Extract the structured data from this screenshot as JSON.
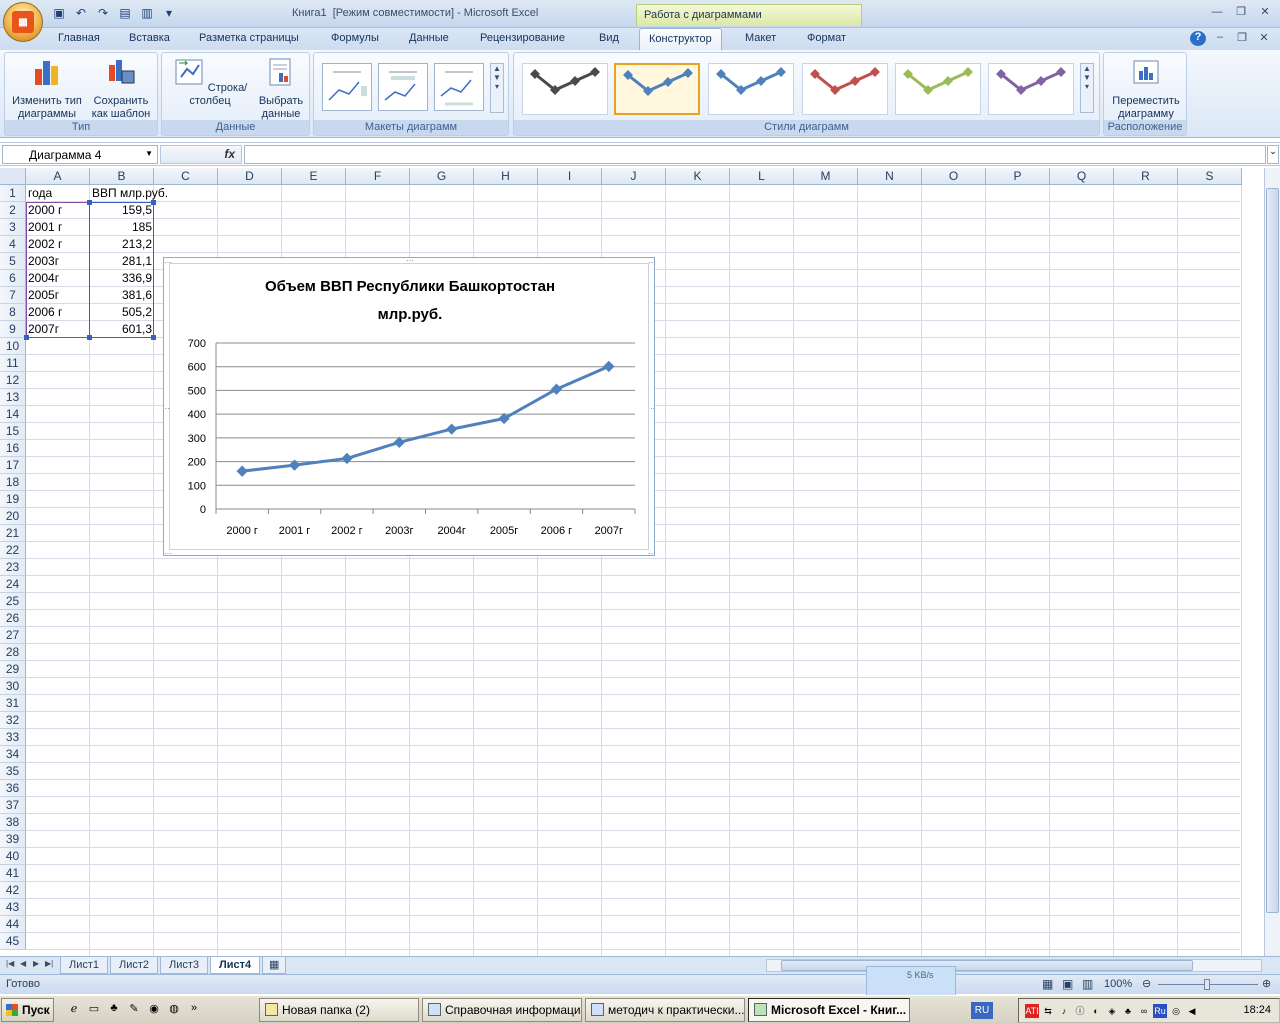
{
  "window": {
    "title": "Книга1  [Режим совместимости] - Microsoft Excel",
    "context_tab_header": "Работа с диаграммами"
  },
  "tabs": [
    "Главная",
    "Вставка",
    "Разметка страницы",
    "Формулы",
    "Данные",
    "Рецензирование",
    "Вид",
    "Конструктор",
    "Макет",
    "Формат"
  ],
  "active_tab": "Конструктор",
  "ribbon": {
    "type_group": {
      "label": "Тип",
      "change_type": "Изменить тип диаграммы",
      "save_template": "Сохранить как шаблон"
    },
    "data_group": {
      "label": "Данные",
      "row_col": "Строка/столбец",
      "select_data": "Выбрать данные"
    },
    "layouts_group": {
      "label": "Макеты диаграмм"
    },
    "styles_group": {
      "label": "Стили диаграмм",
      "style_colors": [
        "#4a4a4a",
        "#4f81bd",
        "#4f81bd",
        "#c0504d",
        "#9bbb59",
        "#8064a2"
      ],
      "selected_style": 1
    },
    "location_group": {
      "label": "Расположение",
      "move_chart": "Переместить диаграмму"
    }
  },
  "formula_bar": {
    "name_box": "Диаграмма 4",
    "fx": "fx",
    "value": ""
  },
  "columns": [
    "A",
    "B",
    "C",
    "D",
    "E",
    "F",
    "G",
    "H",
    "I",
    "J",
    "K",
    "L",
    "M",
    "N",
    "O",
    "P",
    "Q",
    "R",
    "S"
  ],
  "row_count": 45,
  "cells": {
    "header": [
      "года",
      "ВВП млр.руб."
    ],
    "rows": [
      [
        "2000 г",
        "159,5"
      ],
      [
        "2001 г",
        "185"
      ],
      [
        "2002 г",
        "213,2"
      ],
      [
        "2003г",
        "281,1"
      ],
      [
        "2004г",
        "336,9"
      ],
      [
        "2005г",
        "381,6"
      ],
      [
        "2006 г",
        "505,2"
      ],
      [
        "2007г",
        "601,3"
      ]
    ]
  },
  "chart_data": {
    "type": "line",
    "title": "Объем ВВП Республики Башкортостан млр.руб.",
    "title_lines": [
      "Объем ВВП Республики Башкортостан",
      "млр.руб."
    ],
    "categories": [
      "2000 г",
      "2001 г",
      "2002 г",
      "2003г",
      "2004г",
      "2005г",
      "2006 г",
      "2007г"
    ],
    "series": [
      {
        "values": [
          159.5,
          185,
          213.2,
          281.1,
          336.9,
          381.6,
          505.2,
          601.3
        ],
        "color": "#4f81bd"
      }
    ],
    "y_ticks": [
      "0",
      "100",
      "200",
      "300",
      "400",
      "500",
      "600",
      "700"
    ],
    "ylim": [
      0,
      700
    ],
    "grid": true,
    "legend": "none"
  },
  "sheets": [
    "Лист1",
    "Лист2",
    "Лист3",
    "Лист4"
  ],
  "active_sheet": "Лист4",
  "status": {
    "ready": "Готово",
    "zoom": "100%",
    "net": "5 KB/s"
  },
  "taskbar": {
    "start": "Пуск",
    "items": [
      "Новая папка (2)",
      "Справочная информаци...",
      "методич к практически...",
      "Microsoft Excel - Книг..."
    ],
    "lang": "RU",
    "clock": "18:24"
  }
}
